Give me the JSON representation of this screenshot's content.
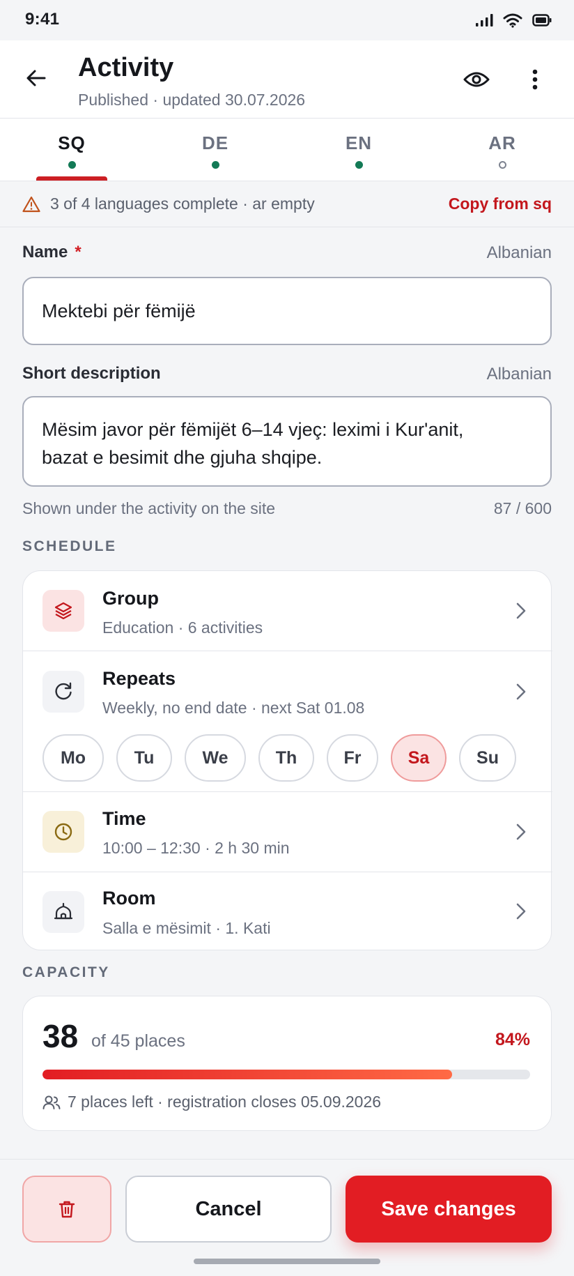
{
  "status_bar": {
    "time": "9:41"
  },
  "header": {
    "title": "Activity",
    "subtitle": "Published · updated 30.07.2026"
  },
  "tabs": [
    {
      "code": "SQ",
      "complete": true,
      "active": true
    },
    {
      "code": "DE",
      "complete": true,
      "active": false
    },
    {
      "code": "EN",
      "complete": true,
      "active": false
    },
    {
      "code": "AR",
      "complete": false,
      "active": false
    }
  ],
  "notice": {
    "text": "3 of 4 languages complete · ar empty",
    "action": "Copy from sq"
  },
  "form": {
    "name_label": "Name",
    "name_required_mark": "*",
    "name_lang": "Albanian",
    "name_value": "Mektebi për fëmijë",
    "desc_label": "Short description",
    "desc_lang": "Albanian",
    "desc_line1": "Mësim javor për fëmijët 6–14 vjeç: leximi i Kur'anit,",
    "desc_line2": "bazat e besimit dhe gjuha shqipe.",
    "desc_hint": "Shown under the activity on the site",
    "desc_counter": "87 / 600"
  },
  "schedule": {
    "section_title": "SCHEDULE",
    "group": {
      "title": "Group",
      "sub": "Education · 6 activities",
      "icon": "layers-icon"
    },
    "repeats": {
      "title": "Repeats",
      "sub": "Weekly, no end date · next Sat 01.08",
      "icon": "refresh-icon"
    },
    "days": [
      {
        "label": "Mo",
        "selected": false
      },
      {
        "label": "Tu",
        "selected": false
      },
      {
        "label": "We",
        "selected": false
      },
      {
        "label": "Th",
        "selected": false
      },
      {
        "label": "Fr",
        "selected": false
      },
      {
        "label": "Sa",
        "selected": true
      },
      {
        "label": "Su",
        "selected": false
      }
    ],
    "time": {
      "title": "Time",
      "sub": "10:00 – 12:30 · 2 h 30 min",
      "icon": "clock-icon"
    },
    "room": {
      "title": "Room",
      "sub": "Salla e mësimit · 1. Kati",
      "icon": "mosque-icon"
    }
  },
  "capacity": {
    "section_title": "CAPACITY",
    "count": "38",
    "of_label": "of 45 places",
    "percent_label": "84%",
    "fill_fraction": 0.84,
    "note": "7 places left · registration closes 05.09.2026"
  },
  "footer": {
    "cancel_label": "Cancel",
    "save_label": "Save changes"
  },
  "colors": {
    "accent": "#e21d23",
    "accent_dark": "#c3171d",
    "complete_dot": "#137a56"
  }
}
